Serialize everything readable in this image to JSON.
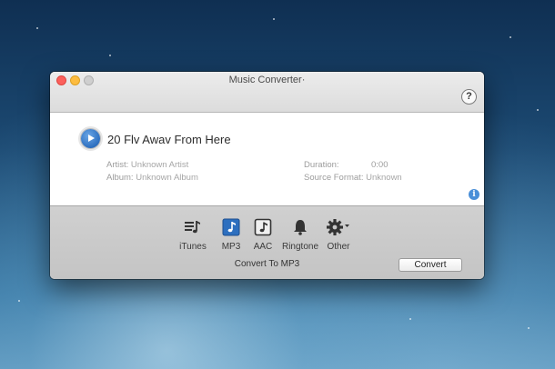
{
  "window": {
    "title": "Music Converter·"
  },
  "header": {
    "help_label": "?"
  },
  "track": {
    "title": "20 Flv Awav From Here",
    "artist_label": "Artist:",
    "artist_value": "Unknown Artist",
    "album_label": "Album:",
    "album_value": "Unknown Album",
    "duration_label": "Duration:",
    "duration_value": "0:00",
    "source_format_label": "Source Format:",
    "source_format_value": "Unknown",
    "info_label": "i"
  },
  "formats": [
    {
      "label": "iTunes",
      "icon": "itunes-list-icon"
    },
    {
      "label": "MP3",
      "icon": "music-note-icon",
      "selected": true
    },
    {
      "label": "AAC",
      "icon": "aac-note-icon"
    },
    {
      "label": "Ringtone",
      "icon": "bell-icon"
    },
    {
      "label": "Other",
      "icon": "gear-icon"
    }
  ],
  "footer": {
    "convert_to_label": "Convert To MP3",
    "convert_button": "Convert"
  },
  "colors": {
    "selected_accent": "#2d6fbf",
    "play_button": "#2d6fbf",
    "info_icon": "#4a8fd8"
  }
}
